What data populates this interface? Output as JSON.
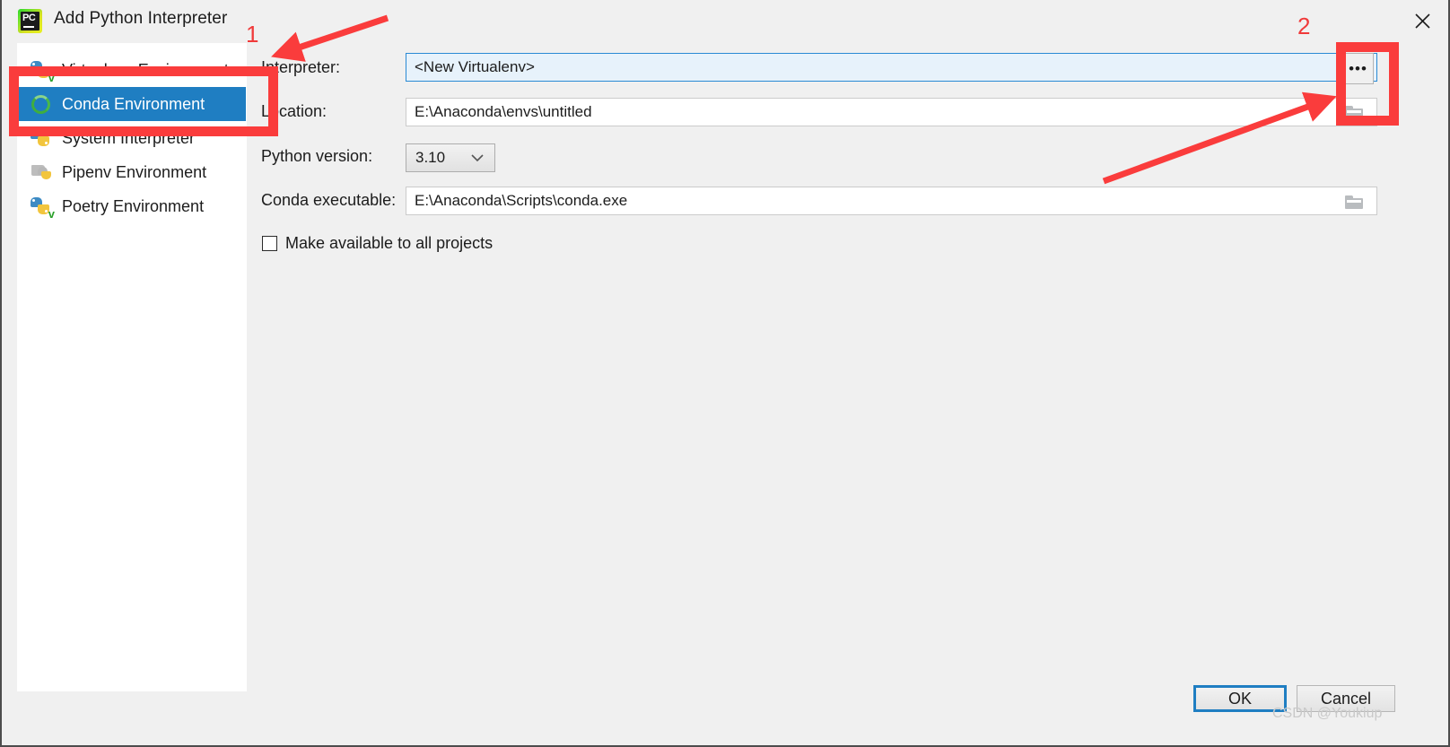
{
  "window": {
    "title": "Add Python Interpreter",
    "logo_icon": "pycharm-logo",
    "close_icon": "close-icon"
  },
  "sidebar": {
    "items": [
      {
        "label": "Virtualenv Environment",
        "icon": "python-virtualenv-icon",
        "selected": false
      },
      {
        "label": "Conda Environment",
        "icon": "conda-icon",
        "selected": true
      },
      {
        "label": "System Interpreter",
        "icon": "python-system-icon",
        "selected": false
      },
      {
        "label": "Pipenv Environment",
        "icon": "python-pipenv-icon",
        "selected": false
      },
      {
        "label": "Poetry Environment",
        "icon": "python-poetry-icon",
        "selected": false
      }
    ]
  },
  "form": {
    "interpreter": {
      "label": "Interpreter:",
      "value": "<New Virtualenv>",
      "chevron_icon": "chevron-down-icon"
    },
    "location": {
      "label": "Location:",
      "value": "E:\\Anaconda\\envs\\untitled",
      "browse_icon": "folder-icon"
    },
    "python_version": {
      "label": "Python version:",
      "value": "3.10",
      "chevron_icon": "chevron-down-icon"
    },
    "conda_executable": {
      "label": "Conda executable:",
      "value": "E:\\Anaconda\\Scripts\\conda.exe",
      "browse_icon": "folder-icon"
    },
    "make_available": {
      "label": "Make available to all projects",
      "checked": false
    },
    "more_button": {
      "label": "•••",
      "icon": "ellipsis-icon"
    }
  },
  "footer": {
    "ok_label": "OK",
    "cancel_label": "Cancel"
  },
  "watermark": {
    "text": "CSDN @Youkiup"
  },
  "annotations": {
    "number_1": "1",
    "number_2": "2",
    "accent_color": "#fa3c3c"
  },
  "colors": {
    "selection_blue": "#1f7ec2",
    "combo_fill": "#e7f2fb",
    "combo_border": "#2a8ad4",
    "dialog_bg": "#f0f0f0",
    "panel_bg": "#ffffff",
    "annotation_red": "#fa3c3c"
  }
}
